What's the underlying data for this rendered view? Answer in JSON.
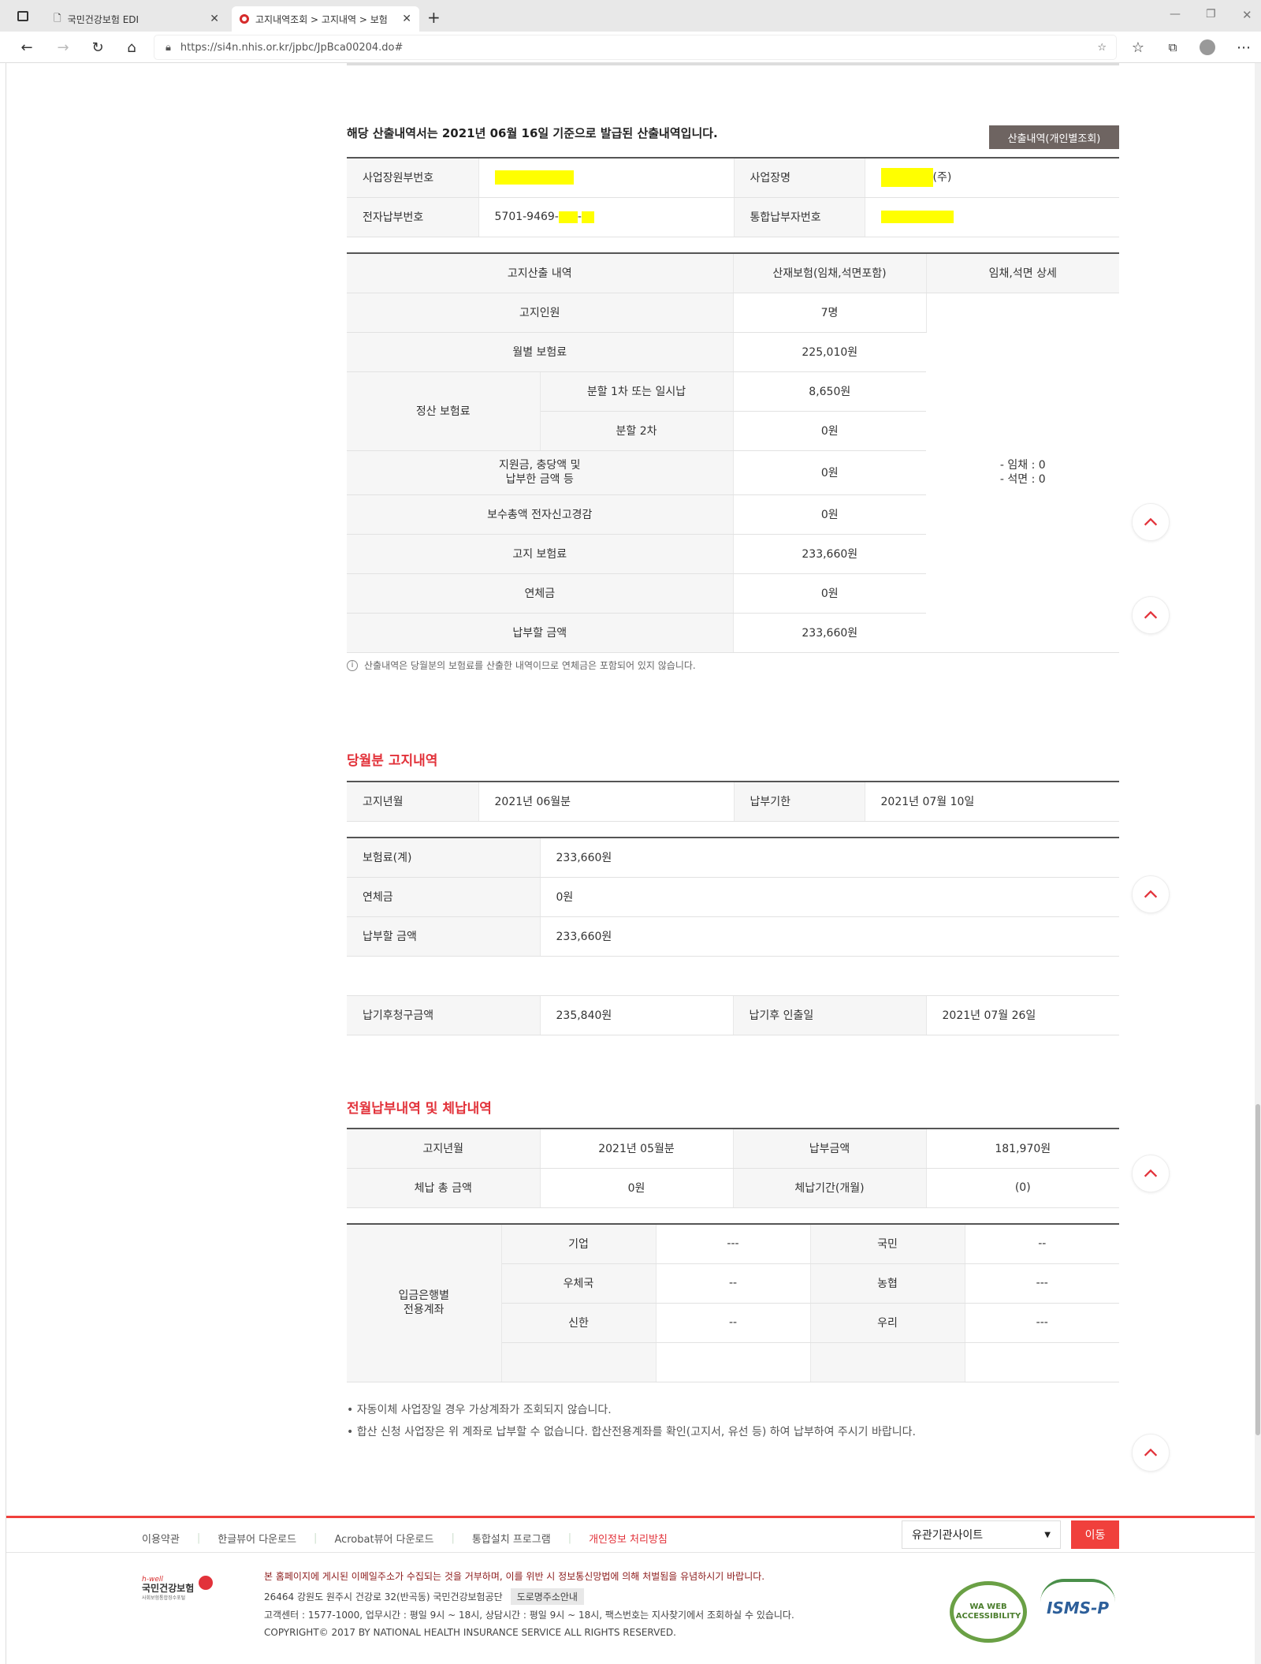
{
  "browser": {
    "tabs": [
      {
        "title": "국민건강보험 EDI",
        "icon": "page-icon"
      },
      {
        "title": "고지내역조회 > 고지내역 > 보험",
        "icon": "nhis-favicon"
      }
    ],
    "url": "https://si4n.nhis.or.kr/jpbc/JpBca00204.do#"
  },
  "header": {
    "notice": "해당 산출내역서는 2021년 06월 16일 기준으로 발급된 산출내역입니다.",
    "button": "산출내역(개인별조회)"
  },
  "info": {
    "labels": [
      "사업장원부번호",
      "사업장명",
      "전자납부번호",
      "통합납부자번호"
    ],
    "company_suffix": "(주)",
    "epay_prefix": "5701-9469-",
    "epay_sep": "-"
  },
  "calc": {
    "headers": [
      "고지산출 내역",
      "산재보험(임채,석면포함)",
      "임채,석면 상세"
    ],
    "rows": [
      {
        "label": "고지인원",
        "value": "7명"
      },
      {
        "label": "월별 보험료",
        "value": "225,010원"
      },
      {
        "group": "정산 보험료",
        "label": "분할 1차 또는 일시납",
        "value": "8,650원"
      },
      {
        "label": "분할 2차",
        "value": "0원"
      },
      {
        "label": "지원금, 충당액 및",
        "label2": "납부한 금액 등",
        "value": "0원"
      },
      {
        "label": "보수총액 전자신고경감",
        "value": "0원"
      },
      {
        "label": "고지 보험료",
        "value": "233,660원"
      },
      {
        "label": "연체금",
        "value": "0원"
      },
      {
        "label": "납부할 금액",
        "value": "233,660원"
      }
    ],
    "detail": [
      "- 임채 : 0",
      "- 석면 : 0"
    ],
    "note": "산출내역은 당월분의 보험료를 산출한 내역이므로 연체금은 포함되어 있지 않습니다."
  },
  "current": {
    "title": "당월분 고지내역",
    "month_label": "고지년월",
    "month": "2021년 06월분",
    "due_label": "납부기한",
    "due": "2021년 07월 10일",
    "rows": [
      {
        "label": "보험료(계)",
        "value": "233,660원"
      },
      {
        "label": "연체금",
        "value": "0원"
      },
      {
        "label": "납부할 금액",
        "value": "233,660원"
      }
    ],
    "late_label": "납기후청구금액",
    "late": "235,840원",
    "late_date_label": "납기후 인출일",
    "late_date": "2021년 07월 26일"
  },
  "previous": {
    "title": "전월납부내역 및 체납내역",
    "month_label": "고지년월",
    "month": "2021년 05월분",
    "paid_label": "납부금액",
    "paid": "181,970원",
    "arrears_label": "체납 총 금액",
    "arrears": "0원",
    "period_label": "체납기간(개월)",
    "period": "(0)"
  },
  "banks": {
    "label1": "입금은행별",
    "label2": "전용계좌",
    "rows": [
      [
        "기업",
        "---",
        "국민",
        "--"
      ],
      [
        "우체국",
        "--",
        "농협",
        "---"
      ],
      [
        "신한",
        "--",
        "우리",
        "---"
      ]
    ]
  },
  "bullets": [
    "자동이체 사업장일 경우 가상계좌가 조회되지 않습니다.",
    "합산 신청 사업장은 위 계좌로 납부할 수 없습니다. 합산전용계좌를 확인(고지서, 유선 등) 하여 납부하여 주시기 바랍니다."
  ],
  "footer": {
    "links": [
      "이용약관",
      "한글뷰어 다운로드",
      "Acrobat뷰어 다운로드",
      "통합설치 프로그램",
      "개인정보 처리방침"
    ],
    "select": "유관기관사이트",
    "go": "이동",
    "warning": "본 홈페이지에 게시된 이메일주소가 수집되는 것을 거부하며, 이를 위반 시 정보통신망법에 의해 처벌됨을 유념하시기 바랍니다.",
    "address": "26464 강원도 원주시 건강로 32(반곡동) 국민건강보험공단",
    "road_btn": "도로명주소안내",
    "contact": "고객센터 : 1577-1000, 업무시간 : 평일 9시 ~ 18시, 상담시간 : 평일 9시 ~ 18시, 팩스번호는 지사찾기에서 조회하실 수 있습니다.",
    "copyright": "COPYRIGHT© 2017 BY NATIONAL HEALTH INSURANCE SERVICE ALL RIGHTS RESERVED.",
    "logo": {
      "brand": "h-well",
      "name": "국민건강보험",
      "sub": "사회보험통합징수포털"
    },
    "badges": [
      "WA WEB ACCESSIBILITY",
      "ISMS-P"
    ]
  },
  "colors": {
    "accent": "#e2323a",
    "button": "#6e6461",
    "redact": "#ffff00"
  }
}
